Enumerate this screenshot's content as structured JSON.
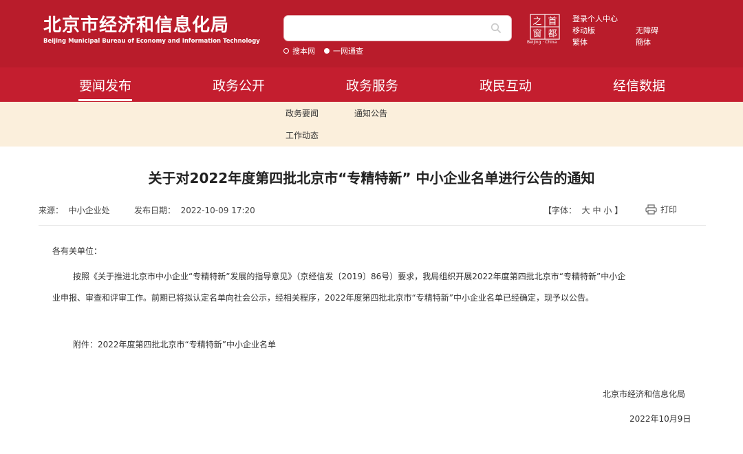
{
  "header": {
    "logo_cn": "北京市经济和信息化局",
    "logo_en": "Beijing Municipal Bureau of Economy and Information Technology",
    "search": {
      "placeholder": "",
      "value": ""
    },
    "scope_options": [
      {
        "label": "搜本网",
        "selected": false
      },
      {
        "label": "一网通查",
        "selected": true
      }
    ],
    "emblem_chars": [
      "之",
      "首",
      "窗",
      "都"
    ],
    "emblem_caption": "Beijing · China",
    "links": {
      "login": "登录个人中心",
      "mobile": "移动版",
      "accessible": "无障碍",
      "traditional": "繁体",
      "simplified": "簡体"
    }
  },
  "nav": {
    "items": [
      "要闻发布",
      "政务公开",
      "政务服务",
      "政民互动",
      "经信数据"
    ],
    "active_index": 0
  },
  "subnav": {
    "items": [
      "政务要闻",
      "通知公告",
      "工作动态"
    ]
  },
  "article": {
    "title": "关于对2022年度第四批北京市“专精特新” 中小企业名单进行公告的通知",
    "source_label": "来源：",
    "source": "中小企业处",
    "date_label": "发布日期：",
    "date": "2022-10-09 17:20",
    "font_label": "【字体：",
    "font_sizes": [
      "大",
      "中",
      "小"
    ],
    "font_close": "】",
    "print_label": "打印",
    "salutation": "各有关单位：",
    "body_line1": "按照《关于推进北京市中小企业“专精特新”发展的指导意见》（京经信发〔2019〕86号）要求，我局组织开展2022年度第四批北京市“专精特新”中小企",
    "body_line2": "业申报、审查和评审工作。前期已将拟认定名单向社会公示，经相关程序，2022年度第四批北京市“专精特新”中小企业名单已经确定，现予以公告。",
    "attachment": "附件：2022年度第四批北京市“专精特新”中小企业名单",
    "signature": "北京市经济和信息化局",
    "sign_date": "2022年10月9日"
  },
  "colors": {
    "header_red": "#b91c2b",
    "nav_red": "#c41e2f",
    "subnav_bg": "#fbefdc"
  }
}
